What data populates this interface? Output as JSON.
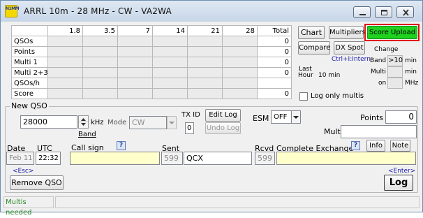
{
  "window": {
    "title": "ARRL 10m -  28 MHz - CW   -   VA2WA",
    "app_icon_text": "N1MM",
    "accent_color": "#3a9a00"
  },
  "score_grid": {
    "headers": [
      "",
      "1.8",
      "3.5",
      "7",
      "14",
      "21",
      "28",
      "Total"
    ],
    "rows": [
      {
        "label": "QSOs",
        "total": "0"
      },
      {
        "label": "Points",
        "total": "0"
      },
      {
        "label": "Multi 1",
        "total": "0"
      },
      {
        "label": "Multi 2+3",
        "total": "0"
      },
      {
        "label": "QSOs/h",
        "total": ""
      },
      {
        "label": "Score",
        "total": "0"
      }
    ]
  },
  "right_panel": {
    "chart": "Chart",
    "multipliers": "Multipliers",
    "score_upload": "Score Upload",
    "compare": "Compare",
    "dx_spot": "DX Spot",
    "ctrl_hint": "Ctrl+I:Intern",
    "change_label": "Change",
    "band_label": "Band",
    "band_value": ">10",
    "min_unit": "min",
    "multi_label": "Multi",
    "on_label": "on",
    "mhz_unit": "MHz",
    "last_label": "Last",
    "hour_label": "Hour",
    "ten_min_label": "10 min",
    "log_only_multis": "Log only multis"
  },
  "new_qso": {
    "group_title": "New QSO",
    "frequency": "28000",
    "khz_label": "kHz",
    "band_label": "Band",
    "mode_label": "Mode",
    "mode_value": "CW",
    "tx_id_label": "TX ID",
    "tx_id_value": "0",
    "edit_log": "Edit Log",
    "undo_log": "Undo Log",
    "esm_label": "ESM",
    "esm_value": "OFF",
    "points_label": "Points",
    "points_value": "0",
    "multi_label": "Multi",
    "multi_value": "",
    "date_label": "Date",
    "date_value": "Feb 11",
    "utc_label": "UTC",
    "utc_value": "22:32",
    "callsign_label": "Call sign",
    "callsign_value": "",
    "sent_label": "Sent",
    "sent_rst": "599",
    "sent_exchange": "QCX",
    "rcvd_label": "Rcvd",
    "rcvd_rst": "599",
    "complete_exchange_label": "Complete Exchange",
    "info": "Info",
    "note": "Note",
    "esc_hint": "<Esc>",
    "remove_qso": "Remove QSO",
    "enter_hint": "<Enter>",
    "log": "Log"
  },
  "status": {
    "left": "Multis needed",
    "right": ""
  }
}
